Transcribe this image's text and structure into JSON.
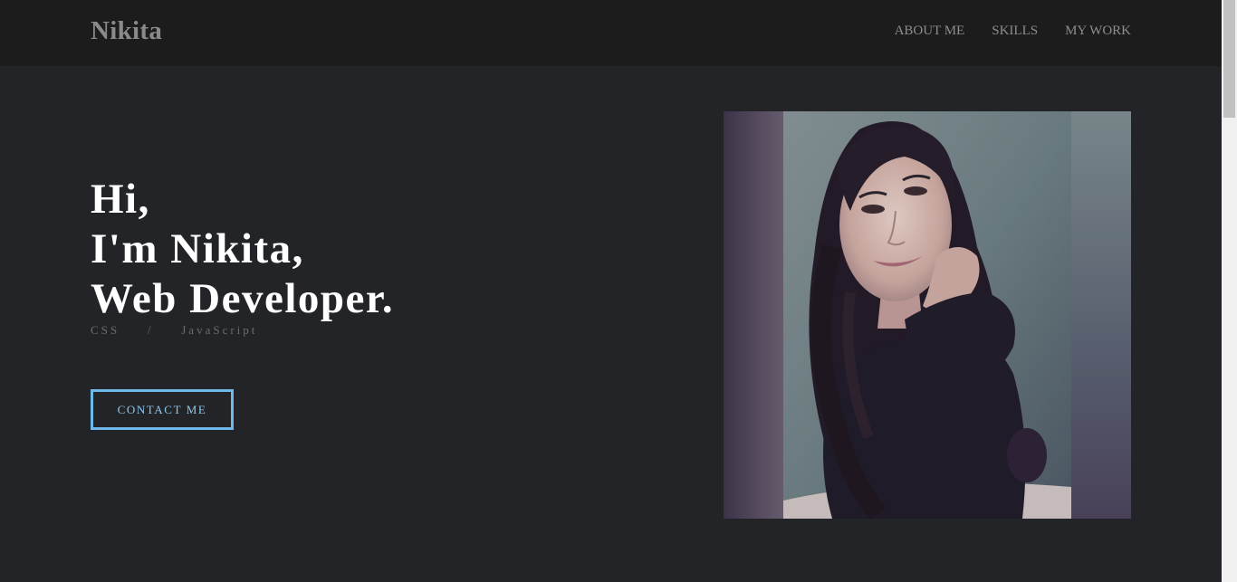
{
  "header": {
    "brand": "Nikita",
    "nav": [
      {
        "label": "ABOUT ME"
      },
      {
        "label": "SKILLS"
      },
      {
        "label": "MY WORK"
      }
    ]
  },
  "hero": {
    "line1": "Hi,",
    "line2": "I'm Nikita,",
    "line3": "Web Developer.",
    "tech": "CSS   /   JavaScript",
    "contact_label": "CONTACT ME"
  },
  "colors": {
    "background": "#232427",
    "header_bg": "#1c1c1c",
    "accent": "#6fb8ea"
  }
}
